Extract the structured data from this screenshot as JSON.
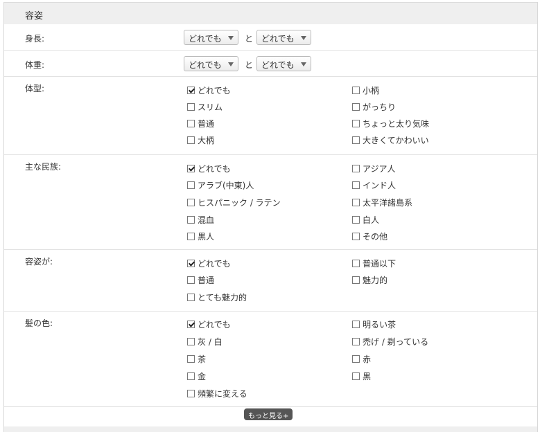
{
  "section": {
    "title": "容姿"
  },
  "height": {
    "label": "身長:",
    "from": "どれでも",
    "between": "と",
    "to": "どれでも"
  },
  "weight": {
    "label": "体重:",
    "from": "どれでも",
    "between": "と",
    "to": "どれでも"
  },
  "body_type": {
    "label": "体型:",
    "left": [
      {
        "label": "どれでも",
        "checked": true
      },
      {
        "label": "スリム",
        "checked": false
      },
      {
        "label": "普通",
        "checked": false
      },
      {
        "label": "大柄",
        "checked": false
      }
    ],
    "right": [
      {
        "label": "小柄",
        "checked": false
      },
      {
        "label": "がっちり",
        "checked": false
      },
      {
        "label": "ちょっと太り気味",
        "checked": false
      },
      {
        "label": "大きくてかわいい",
        "checked": false
      }
    ]
  },
  "ethnicity": {
    "label": "主な民族:",
    "left": [
      {
        "label": "どれでも",
        "checked": true
      },
      {
        "label": "アラブ(中東)人",
        "checked": false
      },
      {
        "label": "ヒスパニック / ラテン",
        "checked": false
      },
      {
        "label": "混血",
        "checked": false
      },
      {
        "label": "黒人",
        "checked": false
      }
    ],
    "right": [
      {
        "label": "アジア人",
        "checked": false
      },
      {
        "label": "インド人",
        "checked": false
      },
      {
        "label": "太平洋諸島系",
        "checked": false
      },
      {
        "label": "白人",
        "checked": false
      },
      {
        "label": "その他",
        "checked": false
      }
    ]
  },
  "appearance": {
    "label": "容姿が:",
    "left": [
      {
        "label": "どれでも",
        "checked": true
      },
      {
        "label": "普通",
        "checked": false
      },
      {
        "label": "とても魅力的",
        "checked": false
      }
    ],
    "right": [
      {
        "label": "普通以下",
        "checked": false
      },
      {
        "label": "魅力的",
        "checked": false
      }
    ]
  },
  "hair_color": {
    "label": "髪の色:",
    "left": [
      {
        "label": "どれでも",
        "checked": true
      },
      {
        "label": "灰 / 白",
        "checked": false
      },
      {
        "label": "茶",
        "checked": false
      },
      {
        "label": "金",
        "checked": false
      },
      {
        "label": "頻繁に変える",
        "checked": false
      }
    ],
    "right": [
      {
        "label": "明るい茶",
        "checked": false
      },
      {
        "label": "禿げ / 剃っている",
        "checked": false
      },
      {
        "label": "赤",
        "checked": false
      },
      {
        "label": "黒",
        "checked": false
      }
    ]
  },
  "more_button": "もっと見る+"
}
